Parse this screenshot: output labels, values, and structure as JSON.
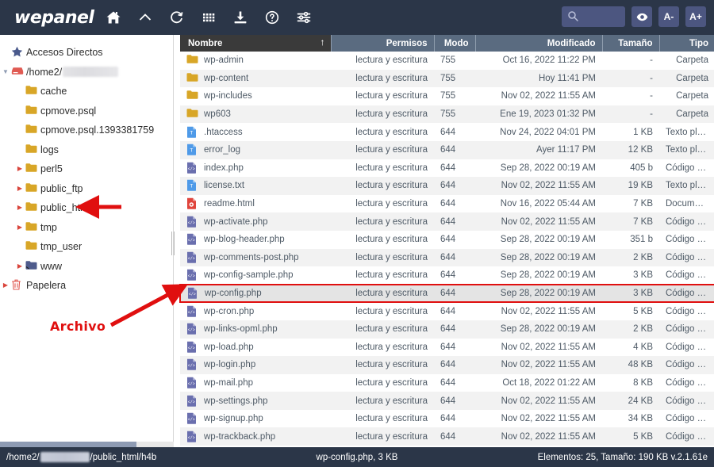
{
  "topbar": {
    "brand": "wepanel",
    "icons": [
      {
        "name": "home-icon",
        "label": "Inicio"
      },
      {
        "name": "chevron-up-icon",
        "label": "Subir"
      },
      {
        "name": "refresh-icon",
        "label": "Recargar"
      },
      {
        "name": "grid-icon",
        "label": "Vista"
      },
      {
        "name": "upload-icon",
        "label": "Cargar"
      },
      {
        "name": "help-icon",
        "label": "Ayuda"
      },
      {
        "name": "settings-sliders-icon",
        "label": "Ajustes"
      }
    ],
    "search": {
      "value": "",
      "placeholder": ""
    },
    "buttons": [
      {
        "name": "eye-icon",
        "label": ""
      },
      {
        "name": "font-decrease-button",
        "label": "A-"
      },
      {
        "name": "font-increase-button",
        "label": "A+"
      }
    ],
    "accent_bg": "#2b3648",
    "button_bg": "#4c5680"
  },
  "sidebar": {
    "items": [
      {
        "label": "Accesos Directos",
        "icon": "star-icon",
        "indent": 0,
        "caret": "none",
        "expanded": false
      },
      {
        "label": "/home2/",
        "icon": "drive-icon",
        "indent": 0,
        "caret": "down",
        "expanded": true,
        "blurred_suffix": true
      },
      {
        "label": "cache",
        "icon": "folder-icon",
        "indent": 1,
        "caret": "none",
        "expanded": false
      },
      {
        "label": "cpmove.psql",
        "icon": "folder-icon",
        "indent": 1,
        "caret": "none",
        "expanded": false
      },
      {
        "label": "cpmove.psql.1393381759",
        "icon": "folder-icon",
        "indent": 1,
        "caret": "none",
        "expanded": false
      },
      {
        "label": "logs",
        "icon": "folder-icon",
        "indent": 1,
        "caret": "none",
        "expanded": false
      },
      {
        "label": "perl5",
        "icon": "folder-icon",
        "indent": 1,
        "caret": "right",
        "expanded": false
      },
      {
        "label": "public_ftp",
        "icon": "folder-icon",
        "indent": 1,
        "caret": "right",
        "expanded": false
      },
      {
        "label": "public_html",
        "icon": "folder-icon",
        "indent": 1,
        "caret": "right",
        "expanded": false
      },
      {
        "label": "tmp",
        "icon": "folder-icon",
        "indent": 1,
        "caret": "right",
        "expanded": false
      },
      {
        "label": "tmp_user",
        "icon": "folder-icon",
        "indent": 1,
        "caret": "none",
        "expanded": false
      },
      {
        "label": "www",
        "icon": "folder-link-icon",
        "indent": 1,
        "caret": "right",
        "expanded": false
      },
      {
        "label": "Papelera",
        "icon": "trash-icon",
        "indent": 0,
        "caret": "right",
        "expanded": false
      }
    ]
  },
  "table": {
    "columns": [
      {
        "key": "name",
        "label": "Nombre",
        "sorted": true,
        "sort_arrow": "↑"
      },
      {
        "key": "perm",
        "label": "Permisos"
      },
      {
        "key": "modo",
        "label": "Modo"
      },
      {
        "key": "mod",
        "label": "Modificado"
      },
      {
        "key": "size",
        "label": "Tamaño"
      },
      {
        "key": "tipo",
        "label": "Tipo"
      }
    ],
    "rows": [
      {
        "name": "wp-admin",
        "icon": "folder-icon",
        "perm": "lectura y escritura",
        "modo": "755",
        "mod": "Oct 16, 2022 11:22 PM",
        "size": "-",
        "tipo": "Carpeta",
        "selected": false
      },
      {
        "name": "wp-content",
        "icon": "folder-icon",
        "perm": "lectura y escritura",
        "modo": "755",
        "mod": "Hoy 11:41 PM",
        "size": "-",
        "tipo": "Carpeta",
        "selected": false
      },
      {
        "name": "wp-includes",
        "icon": "folder-icon",
        "perm": "lectura y escritura",
        "modo": "755",
        "mod": "Nov 02, 2022 11:55 AM",
        "size": "-",
        "tipo": "Carpeta",
        "selected": false
      },
      {
        "name": "wp603",
        "icon": "folder-icon",
        "perm": "lectura y escritura",
        "modo": "755",
        "mod": "Ene 19, 2023 01:32 PM",
        "size": "-",
        "tipo": "Carpeta",
        "selected": false
      },
      {
        "name": ".htaccess",
        "icon": "text-file-icon",
        "perm": "lectura y escritura",
        "modo": "644",
        "mod": "Nov 24, 2022 04:01 PM",
        "size": "1 KB",
        "tipo": "Texto plano",
        "selected": false
      },
      {
        "name": "error_log",
        "icon": "text-file-icon",
        "perm": "lectura y escritura",
        "modo": "644",
        "mod": "Ayer 11:17 PM",
        "size": "12 KB",
        "tipo": "Texto plano",
        "selected": false
      },
      {
        "name": "index.php",
        "icon": "php-file-icon",
        "perm": "lectura y escritura",
        "modo": "644",
        "mod": "Sep 28, 2022 00:19 AM",
        "size": "405 b",
        "tipo": "Código PHP",
        "selected": false
      },
      {
        "name": "license.txt",
        "icon": "text-file-icon",
        "perm": "lectura y escritura",
        "modo": "644",
        "mod": "Nov 02, 2022 11:55 AM",
        "size": "19 KB",
        "tipo": "Texto plano",
        "selected": false
      },
      {
        "name": "readme.html",
        "icon": "html-file-icon",
        "perm": "lectura y escritura",
        "modo": "644",
        "mod": "Nov 16, 2022 05:44 AM",
        "size": "7 KB",
        "tipo": "Documento HTML",
        "selected": false
      },
      {
        "name": "wp-activate.php",
        "icon": "php-file-icon",
        "perm": "lectura y escritura",
        "modo": "644",
        "mod": "Nov 02, 2022 11:55 AM",
        "size": "7 KB",
        "tipo": "Código PHP",
        "selected": false
      },
      {
        "name": "wp-blog-header.php",
        "icon": "php-file-icon",
        "perm": "lectura y escritura",
        "modo": "644",
        "mod": "Sep 28, 2022 00:19 AM",
        "size": "351 b",
        "tipo": "Código PHP",
        "selected": false
      },
      {
        "name": "wp-comments-post.php",
        "icon": "php-file-icon",
        "perm": "lectura y escritura",
        "modo": "644",
        "mod": "Sep 28, 2022 00:19 AM",
        "size": "2 KB",
        "tipo": "Código PHP",
        "selected": false
      },
      {
        "name": "wp-config-sample.php",
        "icon": "php-file-icon",
        "perm": "lectura y escritura",
        "modo": "644",
        "mod": "Sep 28, 2022 00:19 AM",
        "size": "3 KB",
        "tipo": "Código PHP",
        "selected": false
      },
      {
        "name": "wp-config.php",
        "icon": "php-file-icon",
        "perm": "lectura y escritura",
        "modo": "644",
        "mod": "Sep 28, 2022 00:19 AM",
        "size": "3 KB",
        "tipo": "Código PHP",
        "selected": true
      },
      {
        "name": "wp-cron.php",
        "icon": "php-file-icon",
        "perm": "lectura y escritura",
        "modo": "644",
        "mod": "Nov 02, 2022 11:55 AM",
        "size": "5 KB",
        "tipo": "Código PHP",
        "selected": false
      },
      {
        "name": "wp-links-opml.php",
        "icon": "php-file-icon",
        "perm": "lectura y escritura",
        "modo": "644",
        "mod": "Sep 28, 2022 00:19 AM",
        "size": "2 KB",
        "tipo": "Código PHP",
        "selected": false
      },
      {
        "name": "wp-load.php",
        "icon": "php-file-icon",
        "perm": "lectura y escritura",
        "modo": "644",
        "mod": "Nov 02, 2022 11:55 AM",
        "size": "4 KB",
        "tipo": "Código PHP",
        "selected": false
      },
      {
        "name": "wp-login.php",
        "icon": "php-file-icon",
        "perm": "lectura y escritura",
        "modo": "644",
        "mod": "Nov 02, 2022 11:55 AM",
        "size": "48 KB",
        "tipo": "Código PHP",
        "selected": false
      },
      {
        "name": "wp-mail.php",
        "icon": "php-file-icon",
        "perm": "lectura y escritura",
        "modo": "644",
        "mod": "Oct 18, 2022 01:22 AM",
        "size": "8 KB",
        "tipo": "Código PHP",
        "selected": false
      },
      {
        "name": "wp-settings.php",
        "icon": "php-file-icon",
        "perm": "lectura y escritura",
        "modo": "644",
        "mod": "Nov 02, 2022 11:55 AM",
        "size": "24 KB",
        "tipo": "Código PHP",
        "selected": false
      },
      {
        "name": "wp-signup.php",
        "icon": "php-file-icon",
        "perm": "lectura y escritura",
        "modo": "644",
        "mod": "Nov 02, 2022 11:55 AM",
        "size": "34 KB",
        "tipo": "Código PHP",
        "selected": false
      },
      {
        "name": "wp-trackback.php",
        "icon": "php-file-icon",
        "perm": "lectura y escritura",
        "modo": "644",
        "mod": "Nov 02, 2022 11:55 AM",
        "size": "5 KB",
        "tipo": "Código PHP",
        "selected": false
      }
    ]
  },
  "statusbar": {
    "path_prefix": "/home2/",
    "path_suffix": "/public_html/h4b",
    "selection": "wp-config.php, 3 KB",
    "summary": "Elementos: 25, Tamaño: 190 KB v.2.1.61e"
  },
  "annotations": [
    {
      "name": "annotation-label-archivo",
      "text": "Archivo",
      "color": "#e00f0f"
    }
  ]
}
